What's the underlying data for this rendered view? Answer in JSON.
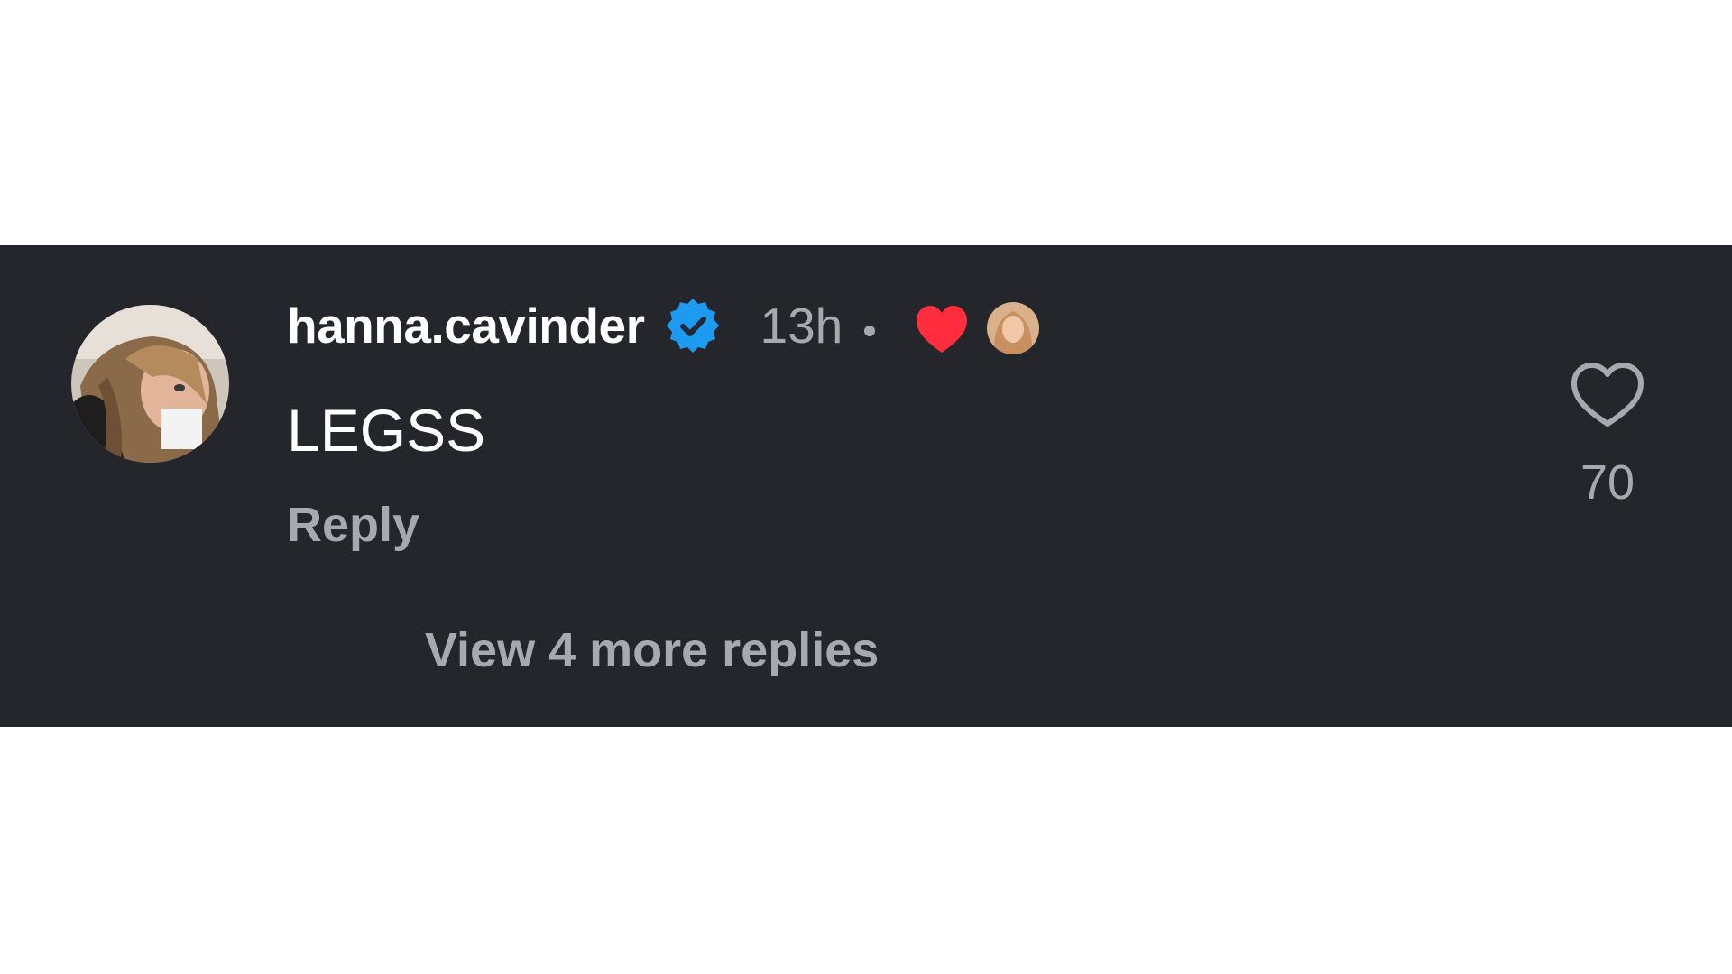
{
  "comment": {
    "username": "hanna.cavinder",
    "verified": true,
    "timestamp": "13h",
    "liked_by_creator": true,
    "text": "LEGSS",
    "reply_label": "Reply",
    "like_count": "70",
    "view_replies_label": "View 4 more replies"
  },
  "icons": {
    "verified": "verified-badge-icon",
    "creator_heart": "heart-filled-icon",
    "like": "heart-outline-icon"
  },
  "colors": {
    "panel_background": "#24262c",
    "verified_blue": "#1d9bf0",
    "heart_red": "#ff2d3d",
    "secondary_text": "#a6a9b0",
    "primary_text": "#ffffff"
  }
}
